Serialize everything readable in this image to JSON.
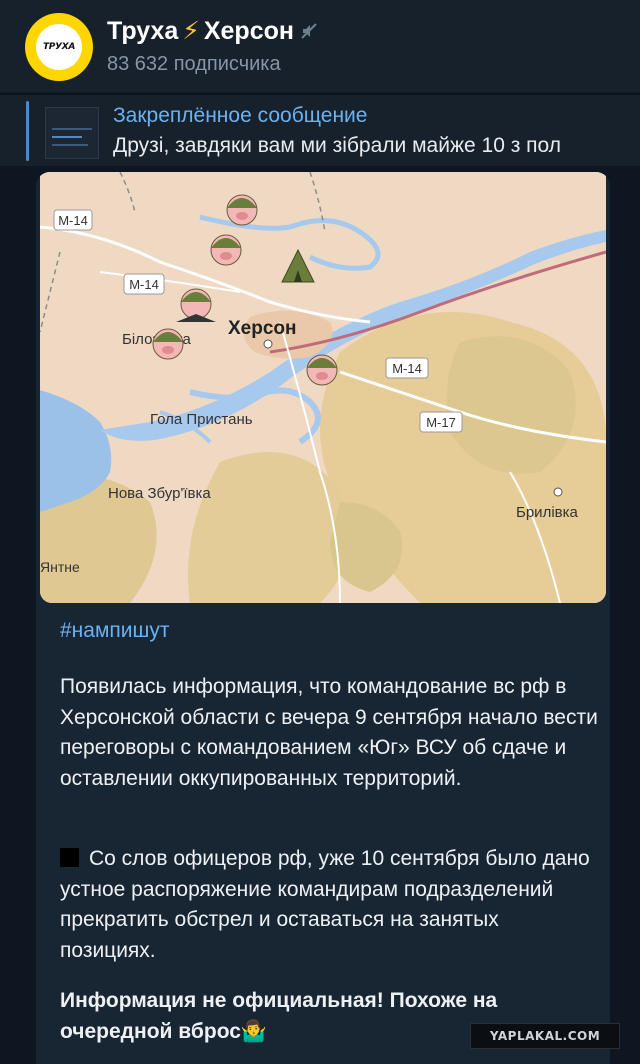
{
  "header": {
    "avatar_text": "ТРУХА",
    "title_part1": "Труха",
    "title_bolt": "⚡",
    "title_part2": "Херсон",
    "subscribers": "83 632 подписчика"
  },
  "pinned": {
    "title": "Закреплённое сообщение",
    "text": "Друзі, завдяки вам ми зібрали майже 10 з пол"
  },
  "map": {
    "city_label": "Херсон",
    "places": [
      "Білозерка",
      "Гола Пристань",
      "Нова Збур'ївка",
      "Брилівка",
      "Янтне"
    ],
    "road_labels": [
      "М-14",
      "М-14",
      "М-14",
      "М-17"
    ]
  },
  "message": {
    "hashtag": "#нампишут",
    "para1": "Появилась информация, что командование вс рф в Херсонской области с вечера 9 сентября начало вести переговоры с командованием «Юг» ВСУ об сдаче и оставлении оккупированных территорий.",
    "para2": "Со слов офицеров рф, уже 10 сентября было дано устное распоряжение командирам подразделений прекратить обстрел и оставаться на занятых позициях.",
    "para3": "Информация не официальная! Похоже на очередной вброс🤷‍♂️"
  },
  "watermark": "YAPLAKAL.COM",
  "colors": {
    "background": "#0e1621",
    "header": "#17212b",
    "bubble": "#182533",
    "link": "#6ab2f2",
    "avatar": "#ffd600"
  },
  "icons": [
    "mute-icon",
    "pin-thumbnail",
    "soldier-pig-icon",
    "tent-icon",
    "plane-soldier-icon"
  ]
}
